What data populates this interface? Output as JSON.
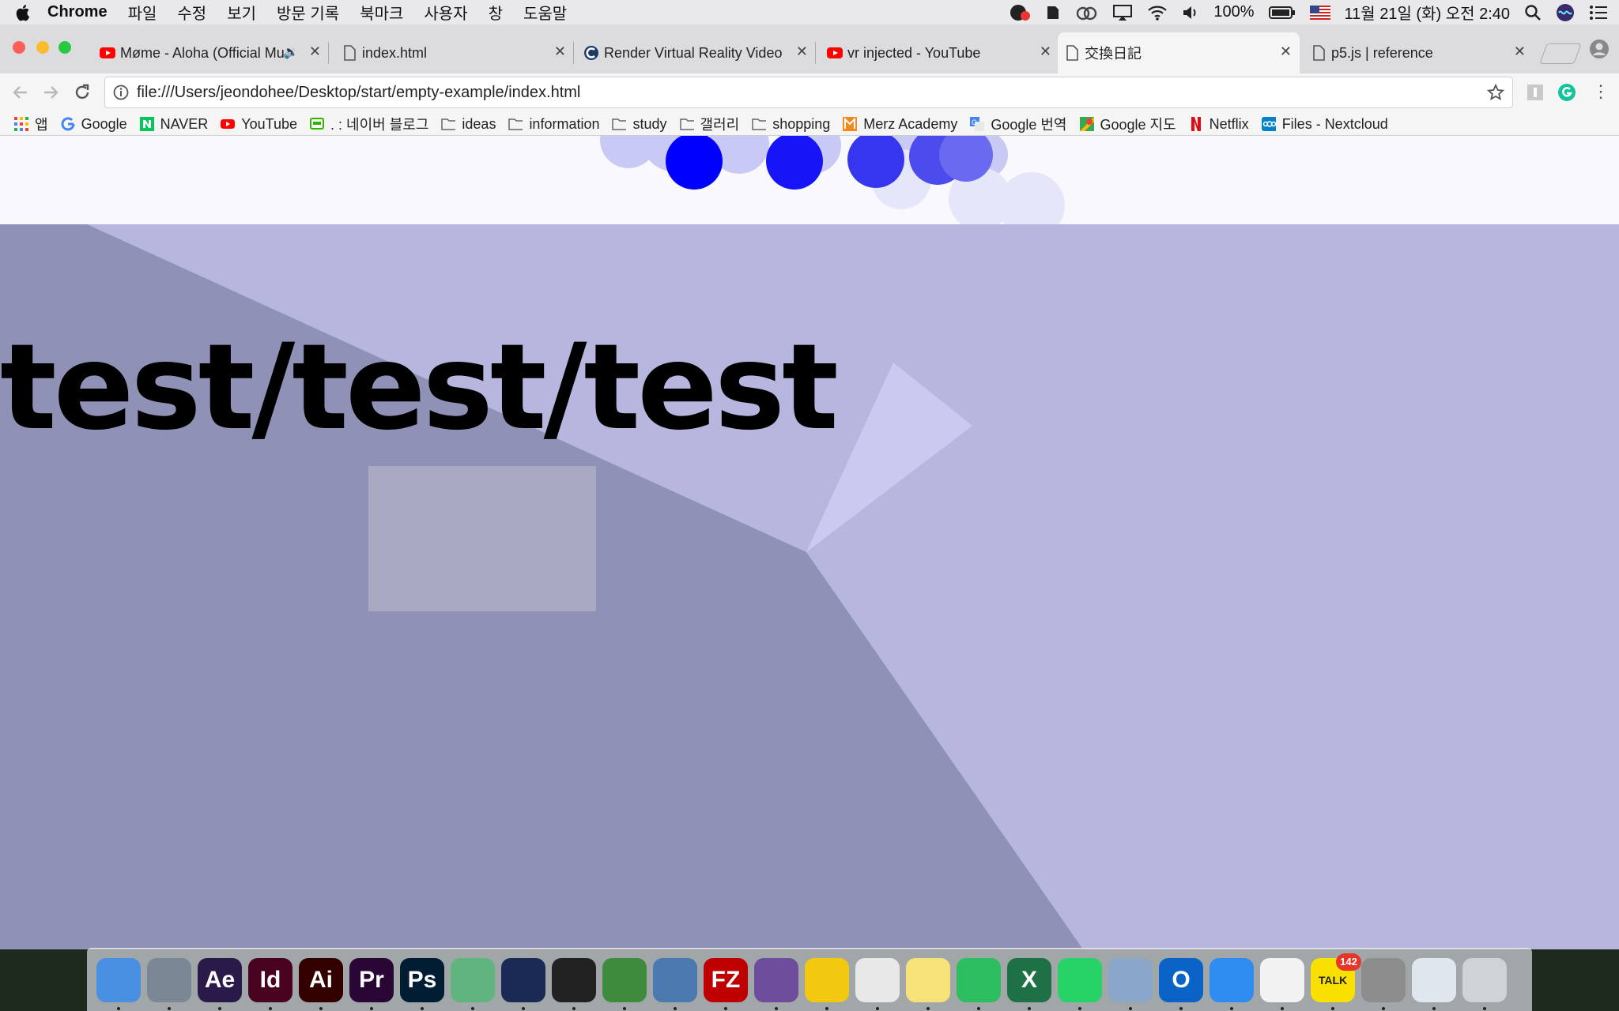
{
  "menubar": {
    "app_name": "Chrome",
    "menus": [
      "파일",
      "수정",
      "보기",
      "방문 기록",
      "북마크",
      "사용자",
      "창",
      "도움말"
    ],
    "battery": "100%",
    "datetime": "11월 21일 (화) 오전 2:40"
  },
  "tabs": [
    {
      "title": "Møme - Aloha (Official Mu",
      "icon": "youtube-icon"
    },
    {
      "title": "index.html",
      "icon": "file-icon"
    },
    {
      "title": "Render Virtual Reality Video",
      "icon": "c-logo-icon"
    },
    {
      "title": "vr injected - YouTube",
      "icon": "youtube-icon"
    },
    {
      "title": "交換日記",
      "icon": "file-icon",
      "active": true
    },
    {
      "title": "p5.js | reference",
      "icon": "file-icon"
    }
  ],
  "address_bar": {
    "url": "file:///Users/jeondohee/Desktop/start/empty-example/index.html"
  },
  "bookmarks": [
    {
      "label": "앱",
      "icon": "apps-grid-icon"
    },
    {
      "label": "Google",
      "icon": "google-icon"
    },
    {
      "label": "NAVER",
      "icon": "naver-icon"
    },
    {
      "label": "YouTube",
      "icon": "youtube-icon"
    },
    {
      "label": ". : 네이버 블로그",
      "icon": "blog-icon"
    },
    {
      "label": "ideas",
      "icon": "folder-icon"
    },
    {
      "label": "information",
      "icon": "folder-icon"
    },
    {
      "label": "study",
      "icon": "folder-icon"
    },
    {
      "label": "갤러리",
      "icon": "folder-icon"
    },
    {
      "label": "shopping",
      "icon": "folder-icon"
    },
    {
      "label": "Merz Academy",
      "icon": "merz-icon"
    },
    {
      "label": "Google 번역",
      "icon": "translate-icon"
    },
    {
      "label": "Google 지도",
      "icon": "maps-icon"
    },
    {
      "label": "Netflix",
      "icon": "netflix-icon"
    },
    {
      "label": "Files - Nextcloud",
      "icon": "nextcloud-icon"
    }
  ],
  "page": {
    "heading": "test/test/test"
  },
  "dock": [
    {
      "name": "finder-icon",
      "label": "",
      "color": "#4a90e2"
    },
    {
      "name": "launchpad-icon",
      "label": "",
      "color": "#7b8794"
    },
    {
      "name": "after-effects-icon",
      "label": "Ae",
      "color": "#2a1a4a"
    },
    {
      "name": "indesign-icon",
      "label": "Id",
      "color": "#49021f"
    },
    {
      "name": "illustrator-icon",
      "label": "Ai",
      "color": "#330000"
    },
    {
      "name": "premiere-icon",
      "label": "Pr",
      "color": "#2a0634"
    },
    {
      "name": "photoshop-icon",
      "label": "Ps",
      "color": "#001d34"
    },
    {
      "name": "atom-icon",
      "label": "",
      "color": "#5fb57d"
    },
    {
      "name": "cinema4d-icon",
      "label": "",
      "color": "#1b2a55"
    },
    {
      "name": "unity-icon",
      "label": "",
      "color": "#222222"
    },
    {
      "name": "android-studio-icon",
      "label": "",
      "color": "#3d8b3d"
    },
    {
      "name": "python-launcher-icon",
      "label": "",
      "color": "#4a7ab0"
    },
    {
      "name": "filezilla-icon",
      "label": "FZ",
      "color": "#bf0000"
    },
    {
      "name": "github-desktop-icon",
      "label": "",
      "color": "#6e4c9c"
    },
    {
      "name": "cyberduck-icon",
      "label": "",
      "color": "#f2c811"
    },
    {
      "name": "chrome-icon",
      "label": "",
      "color": "#e8e8e8"
    },
    {
      "name": "notes-icon",
      "label": "",
      "color": "#f7e27a"
    },
    {
      "name": "evernote-icon",
      "label": "",
      "color": "#2dbe60"
    },
    {
      "name": "excel-icon",
      "label": "X",
      "color": "#1e7145"
    },
    {
      "name": "whatsapp-icon",
      "label": "",
      "color": "#25d366"
    },
    {
      "name": "preview-icon",
      "label": "",
      "color": "#8aa6c8"
    },
    {
      "name": "outlook-icon",
      "label": "O",
      "color": "#0a64c8"
    },
    {
      "name": "safari-icon",
      "label": "",
      "color": "#2f8cf0"
    },
    {
      "name": "itunes-icon",
      "label": "",
      "color": "#f2f2f2"
    },
    {
      "name": "kakaotalk-icon",
      "label": "TALK",
      "color": "#f9e000",
      "badge": "142"
    },
    {
      "name": "system-preferences-icon",
      "label": "",
      "color": "#8d8d8d"
    },
    {
      "name": "python-icon",
      "label": "",
      "color": "#dfe6ee"
    },
    {
      "name": "trash-icon",
      "label": "",
      "color": "#cfd3d8"
    }
  ]
}
